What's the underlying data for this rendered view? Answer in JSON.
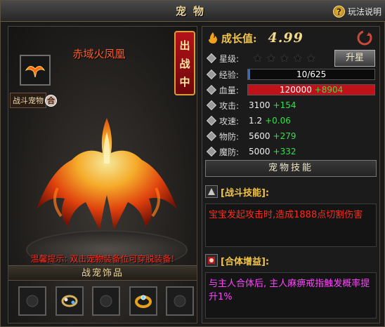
{
  "window": {
    "title": "宠物"
  },
  "help": {
    "icon": "question-icon",
    "label": "玩法说明"
  },
  "pet": {
    "name": "赤域火凤凰",
    "badge": "出战中",
    "tag_label": "战斗宠物",
    "tag_badge": "合",
    "warning_label": "温馨提示:",
    "warning_text": " 双击宠物装备位可穿脱装备!",
    "accessories_title": "战宠饰品"
  },
  "stats": {
    "growth_label": "成长值:",
    "growth_value": "4.99",
    "star_label": "星级:",
    "star_count": 0,
    "star_max": 5,
    "upgrade_label": "升星",
    "exp_label": "经验:",
    "exp_text": "10/625",
    "exp_fraction": 0.016,
    "hp_label": "血量:",
    "hp_value": "120000",
    "hp_bonus": "+8904",
    "attack_label": "攻击:",
    "attack_value": "3100",
    "attack_bonus": "+154",
    "speed_label": "攻速:",
    "speed_value": "1.2",
    "speed_bonus": "+0.06",
    "pdef_label": "物防:",
    "pdef_value": "5600",
    "pdef_bonus": "+279",
    "mdef_label": "魔防:",
    "mdef_value": "5000",
    "mdef_bonus": "+332"
  },
  "skills": {
    "button_label": "宠物技能",
    "battle_title": "[战斗技能]:",
    "battle_desc": "宝宝发起攻击时,造成1888点切割伤害",
    "merge_title": "[合体增益]:",
    "merge_desc": "与主人合体后, 主人麻痹戒指触发概率提升1%"
  },
  "colors": {
    "accent": "#f2c44a",
    "hp_bar": "#c0101a",
    "exp_bar": "#2a6cd8",
    "bonus": "#35e04a",
    "warning": "#ff2a1a",
    "merge_text": "#ff44ff"
  }
}
